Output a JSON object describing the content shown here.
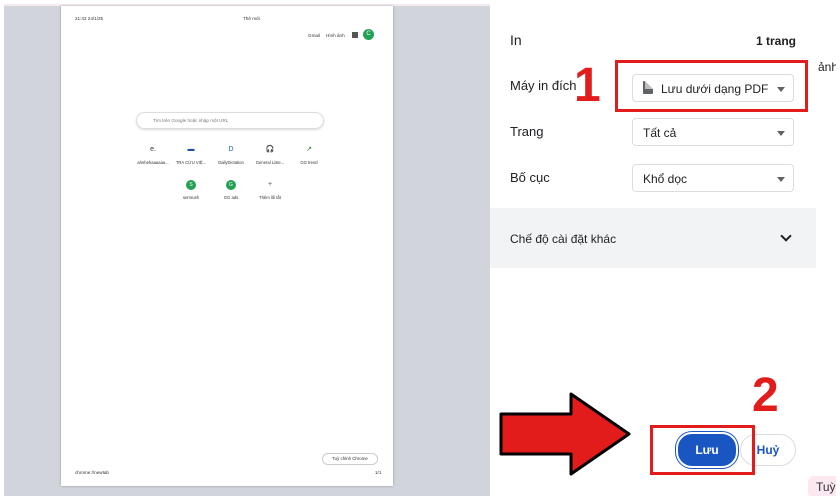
{
  "preview": {
    "datetime": "21:42 24/1/25",
    "tab_title": "Thẻ mới",
    "gmail": "Gmail",
    "images": "Hình ảnh",
    "avatar_letter": "C",
    "search_placeholder": "Tìm trên Google hoặc nhập một URL",
    "shortcuts": [
      {
        "label": "ahehehaaaaaa...",
        "glyph": "e.",
        "icon": "e-logo-icon",
        "color": "#333333"
      },
      {
        "label": "TRA CỨU VIỆ...",
        "glyph": "▬",
        "icon": "id-card-icon",
        "color": "#1e4fa3"
      },
      {
        "label": "DailyDictation",
        "glyph": "D",
        "icon": "d-logo-icon",
        "color": "#1565c0"
      },
      {
        "label": "General Liste...",
        "glyph": "🎧",
        "icon": "headphones-icon",
        "color": "#333333"
      },
      {
        "label": "GG trend",
        "glyph": "↗",
        "icon": "trend-icon",
        "color": "#2e7d32"
      },
      {
        "label": "semrush",
        "glyph": "S",
        "icon": "semrush-icon",
        "color": "#22a053"
      },
      {
        "label": "GG ads",
        "glyph": "G",
        "icon": "gg-ads-icon",
        "color": "#22a053"
      },
      {
        "label": "Thêm lối tắt",
        "glyph": "+",
        "icon": "add-shortcut-icon",
        "color": "#555555"
      }
    ],
    "customize": "Tuỳ chỉnh Chrome",
    "footer_url": "chrome://newtab",
    "page_count": "1/1"
  },
  "panel": {
    "title": "In",
    "pages": "1 trang",
    "destination_label": "Máy in đích",
    "destination_value": "Lưu dưới dạng PDF",
    "pages_label": "Trang",
    "pages_value": "Tất cả",
    "layout_label": "Bố cục",
    "layout_value": "Khổ dọc",
    "more_settings": "Chế độ cài đặt khác",
    "save": "Lưu",
    "cancel": "Huỷ"
  },
  "annotations": {
    "step1": "1",
    "step2": "2",
    "accent": "#e21b1b"
  },
  "background": {
    "anh": "ảnh",
    "tuy": "Tuỳ"
  },
  "colors": {
    "primary": "#1a56c2",
    "preview_bg": "#d1d5db",
    "more_bg": "#f1f3f4"
  }
}
